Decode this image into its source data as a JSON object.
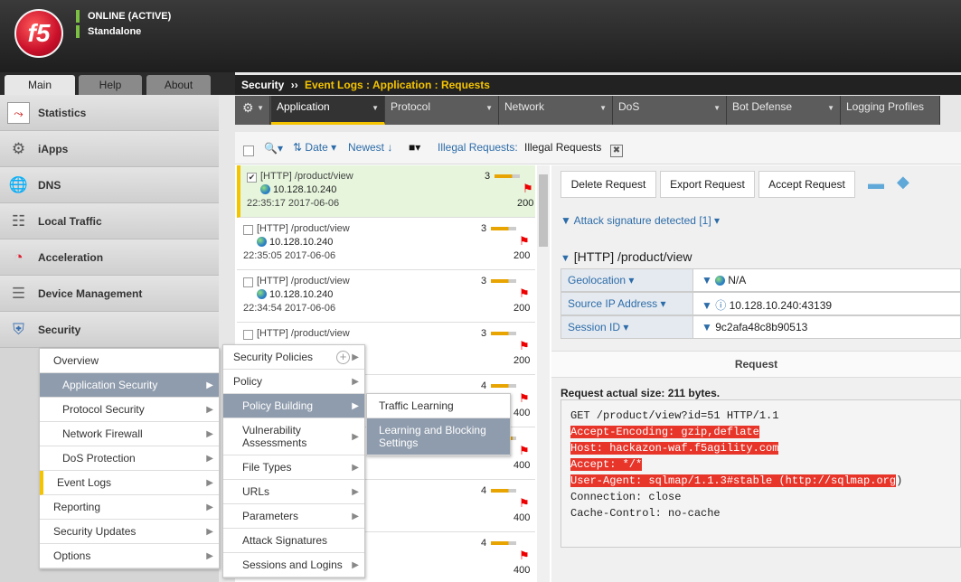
{
  "header": {
    "logo": "f5",
    "status": "ONLINE (ACTIVE)",
    "mode": "Standalone"
  },
  "tabs": [
    {
      "label": "Main",
      "active": true
    },
    {
      "label": "Help",
      "active": false
    },
    {
      "label": "About",
      "active": false
    }
  ],
  "sidebar": {
    "items": [
      {
        "label": "Statistics",
        "icon": "statistics-icon"
      },
      {
        "label": "iApps",
        "icon": "iapps-icon"
      },
      {
        "label": "DNS",
        "icon": "globe-icon"
      },
      {
        "label": "Local Traffic",
        "icon": "local-traffic-icon"
      },
      {
        "label": "Acceleration",
        "icon": "gauge-icon"
      },
      {
        "label": "Device Management",
        "icon": "server-icon"
      },
      {
        "label": "Security",
        "icon": "shield-icon"
      }
    ]
  },
  "breadcrumb": {
    "root": "Security",
    "separator": "››",
    "path": "Event Logs : Application : Requests"
  },
  "nav": {
    "items": [
      "Application",
      "Protocol",
      "Network",
      "DoS",
      "Bot Defense",
      "Logging Profiles"
    ],
    "active": "Application"
  },
  "filter": {
    "date": "Date",
    "sort": "Newest",
    "filter_label": "Illegal Requests:",
    "filter_value": "Illegal Requests"
  },
  "requests": [
    {
      "title": "[HTTP] /product/view",
      "ip": "10.128.10.240",
      "time": "22:35:17 2017-06-06",
      "count": "3",
      "code": "200",
      "checked": true
    },
    {
      "title": "[HTTP] /product/view",
      "ip": "10.128.10.240",
      "time": "22:35:05 2017-06-06",
      "count": "3",
      "code": "200",
      "checked": false
    },
    {
      "title": "[HTTP] /product/view",
      "ip": "10.128.10.240",
      "time": "22:34:54 2017-06-06",
      "count": "3",
      "code": "200",
      "checked": false
    },
    {
      "title": "[HTTP] /product/view",
      "ip": "",
      "time": "",
      "count": "3",
      "code": "200",
      "checked": false
    },
    {
      "title": "",
      "ip": "",
      "time": "",
      "count": "4",
      "code": "400",
      "checked": false
    },
    {
      "title": "",
      "ip": "",
      "time": "",
      "count": "",
      "code": "400",
      "checked": false
    },
    {
      "title": "",
      "ip": "",
      "time": "",
      "count": "4",
      "code": "400",
      "checked": false
    },
    {
      "title": "",
      "ip": "",
      "time": "",
      "count": "4",
      "code": "400",
      "checked": false
    }
  ],
  "detail": {
    "buttons": [
      "Delete Request",
      "Export Request",
      "Accept Request"
    ],
    "attack": "Attack signature detected [1]",
    "title": "[HTTP] /product/view",
    "fields": [
      {
        "label": "Geolocation",
        "value": "N/A"
      },
      {
        "label": "Source IP Address",
        "value": "10.128.10.240:43139"
      },
      {
        "label": "Session ID",
        "value": "9c2afa48c8b90513"
      }
    ],
    "request_tab": "Request",
    "size": "Request actual size: 211 bytes.",
    "lines": [
      {
        "text": "GET /product/view?id=51 HTTP/1.1",
        "hl": false
      },
      {
        "text": "Accept-Encoding: gzip,deflate",
        "hl": true
      },
      {
        "text": "Host: hackazon-waf.f5agility.com",
        "hl": true
      },
      {
        "text": "Accept: */*",
        "hl": true
      },
      {
        "text": "User-Agent: sqlmap/1.1.3#stable (http://sqlmap.org",
        "hl": true,
        "tail": ")"
      },
      {
        "text": "Connection: close",
        "hl": false
      },
      {
        "text": "Cache-Control: no-cache",
        "hl": false
      }
    ]
  },
  "menu1": {
    "items": [
      {
        "label": "Overview",
        "sub": false,
        "selected": false,
        "marker": false
      },
      {
        "label": "Application Security",
        "sub": true,
        "selected": true,
        "marker": false
      },
      {
        "label": "Protocol Security",
        "sub": true,
        "selected": false,
        "marker": false
      },
      {
        "label": "Network Firewall",
        "sub": true,
        "selected": false,
        "marker": false
      },
      {
        "label": "DoS Protection",
        "sub": true,
        "selected": false,
        "marker": false
      },
      {
        "label": "Event Logs",
        "sub": true,
        "selected": false,
        "marker": true
      },
      {
        "label": "Reporting",
        "sub": true,
        "selected": false,
        "marker": false
      },
      {
        "label": "Security Updates",
        "sub": true,
        "selected": false,
        "marker": false
      },
      {
        "label": "Options",
        "sub": true,
        "selected": false,
        "marker": false
      }
    ]
  },
  "menu2": {
    "items": [
      {
        "label": "Security Policies",
        "sub": true,
        "selected": false,
        "plus": true
      },
      {
        "label": "Policy",
        "sub": true,
        "selected": false
      },
      {
        "label": "Policy Building",
        "sub": true,
        "selected": true
      },
      {
        "label": "Vulnerability Assessments",
        "sub": true,
        "selected": false
      },
      {
        "label": "File Types",
        "sub": true,
        "selected": false
      },
      {
        "label": "URLs",
        "sub": true,
        "selected": false
      },
      {
        "label": "Parameters",
        "sub": true,
        "selected": false
      },
      {
        "label": "Attack Signatures",
        "sub": false,
        "selected": false
      },
      {
        "label": "Sessions and Logins",
        "sub": true,
        "selected": false
      }
    ]
  },
  "menu3": {
    "items": [
      {
        "label": "Traffic Learning",
        "selected": false
      },
      {
        "label": "Learning and Blocking Settings",
        "selected": true
      }
    ]
  },
  "colors": {
    "highlight": "#e8352a",
    "menu_selected": "#8f9cad",
    "accent": "#f5c400"
  }
}
